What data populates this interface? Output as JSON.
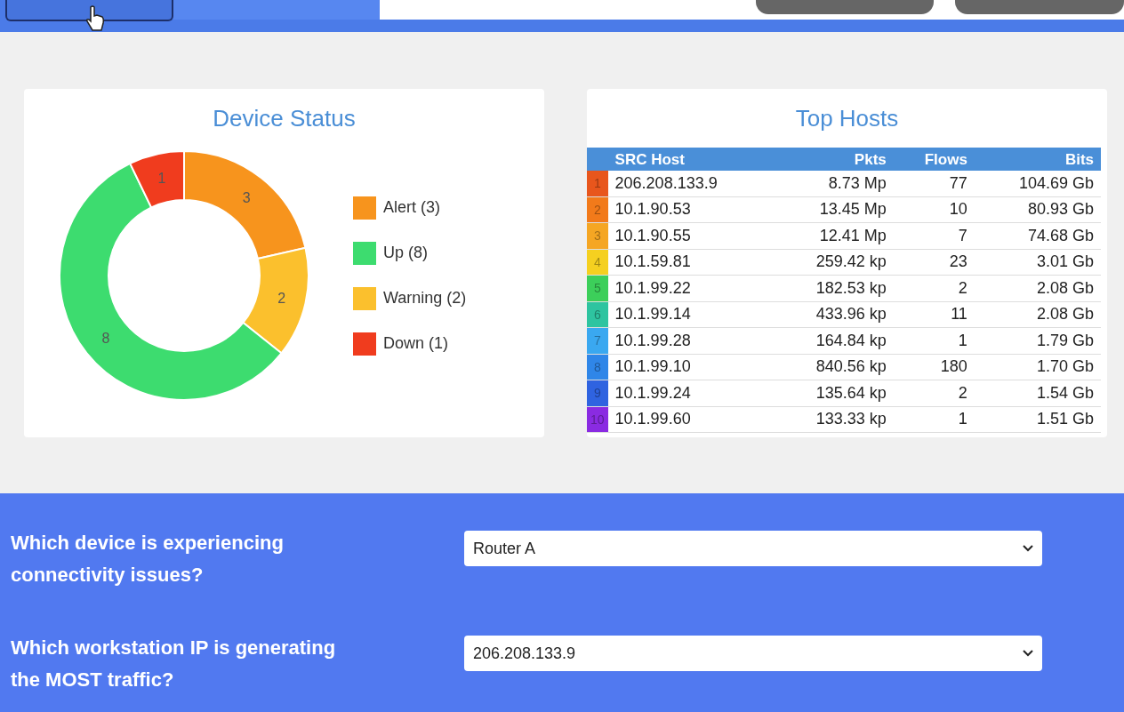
{
  "tabs": [
    {
      "selected": false
    },
    {
      "selected": true
    }
  ],
  "device_status": {
    "title": "Device Status",
    "chart_data": {
      "type": "donut",
      "categories": [
        "Alert (3)",
        "Warning (2)",
        "Up (8)",
        "Down (1)"
      ],
      "series": [
        {
          "values": [
            3,
            2,
            8,
            1
          ]
        }
      ],
      "colors": [
        "#f7941d",
        "#fbc02d",
        "#3ddc6f",
        "#f03c1e"
      ],
      "data_labels": true
    }
  },
  "top_hosts": {
    "title": "Top Hosts",
    "columns": [
      "SRC Host",
      "Pkts",
      "Flows",
      "Bits"
    ],
    "rows": [
      {
        "rank": "1",
        "color": "#e8561c",
        "host": "206.208.133.9",
        "pkts": "8.73 Mp",
        "flows": "77",
        "bits": "104.69 Gb"
      },
      {
        "rank": "2",
        "color": "#f27a1a",
        "host": "10.1.90.53",
        "pkts": "13.45 Mp",
        "flows": "10",
        "bits": "80.93 Gb"
      },
      {
        "rank": "3",
        "color": "#f5a623",
        "host": "10.1.90.55",
        "pkts": "12.41 Mp",
        "flows": "7",
        "bits": "74.68 Gb"
      },
      {
        "rank": "4",
        "color": "#f5d020",
        "host": "10.1.59.81",
        "pkts": "259.42 kp",
        "flows": "23",
        "bits": "3.01 Gb"
      },
      {
        "rank": "5",
        "color": "#3ccf5a",
        "host": "10.1.99.22",
        "pkts": "182.53 kp",
        "flows": "2",
        "bits": "2.08 Gb"
      },
      {
        "rank": "6",
        "color": "#2ec4a0",
        "host": "10.1.99.14",
        "pkts": "433.96 kp",
        "flows": "11",
        "bits": "2.08 Gb"
      },
      {
        "rank": "7",
        "color": "#3aa8f0",
        "host": "10.1.99.28",
        "pkts": "164.84 kp",
        "flows": "1",
        "bits": "1.79 Gb"
      },
      {
        "rank": "8",
        "color": "#2f86e8",
        "host": "10.1.99.10",
        "pkts": "840.56 kp",
        "flows": "180",
        "bits": "1.70 Gb"
      },
      {
        "rank": "9",
        "color": "#2f63e0",
        "host": "10.1.99.24",
        "pkts": "135.64 kp",
        "flows": "2",
        "bits": "1.54 Gb"
      },
      {
        "rank": "10",
        "color": "#8a2be2",
        "host": "10.1.99.60",
        "pkts": "133.33 kp",
        "flows": "1",
        "bits": "1.51 Gb"
      }
    ]
  },
  "questions": [
    {
      "question": "Which device is experiencing connectivity issues?",
      "value": "Router A"
    },
    {
      "question": "Which workstation IP is generating the MOST traffic?",
      "value": "206.208.133.9"
    }
  ]
}
